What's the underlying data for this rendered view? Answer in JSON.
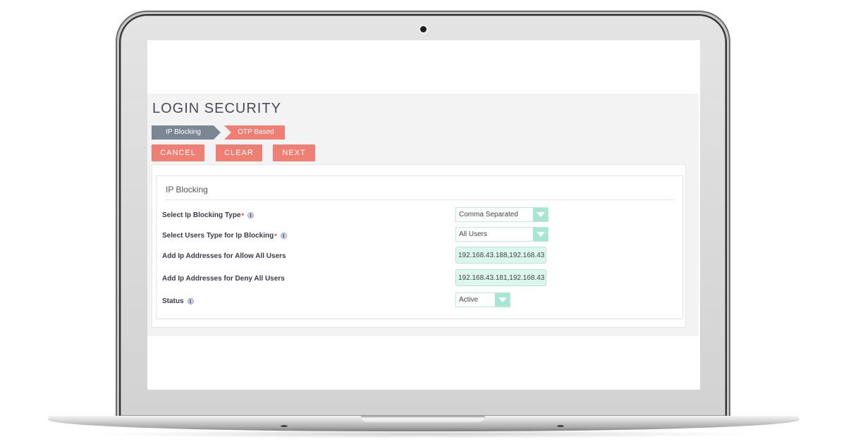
{
  "page": {
    "title": "LOGIN SECURITY"
  },
  "steps": [
    {
      "label": "IP Blocking",
      "state": "active"
    },
    {
      "label": "OTP Based",
      "state": "pending"
    }
  ],
  "actions": {
    "cancel": "CANCEL",
    "clear": "CLEAR",
    "next": "NEXT"
  },
  "panel": {
    "title": "IP Blocking",
    "fields": {
      "blocking_type": {
        "label": "Select Ip Blocking Type",
        "required": "*",
        "info_icon": "info-icon",
        "value": "Comma Separated"
      },
      "users_type": {
        "label": "Select Users Type for Ip Blocking",
        "required": "*",
        "info_icon": "info-icon",
        "value": "All Users"
      },
      "allow_ips": {
        "label": "Add Ip Addresses for Allow All Users",
        "value": "192.168.43.188,192.168.43"
      },
      "deny_ips": {
        "label": "Add Ip Addresses for Deny All Users",
        "value": "192.168.43.181,192.168.43"
      },
      "status": {
        "label": "Status",
        "info_icon": "info-icon",
        "value": "Active"
      }
    }
  },
  "icons": {
    "info": "i"
  },
  "colors": {
    "accent": "#ef7f72",
    "step_active": "#7a8793",
    "select_arrow": "#a7e6d2",
    "input_fill": "#dbf6ec",
    "required": "#e0383a"
  }
}
